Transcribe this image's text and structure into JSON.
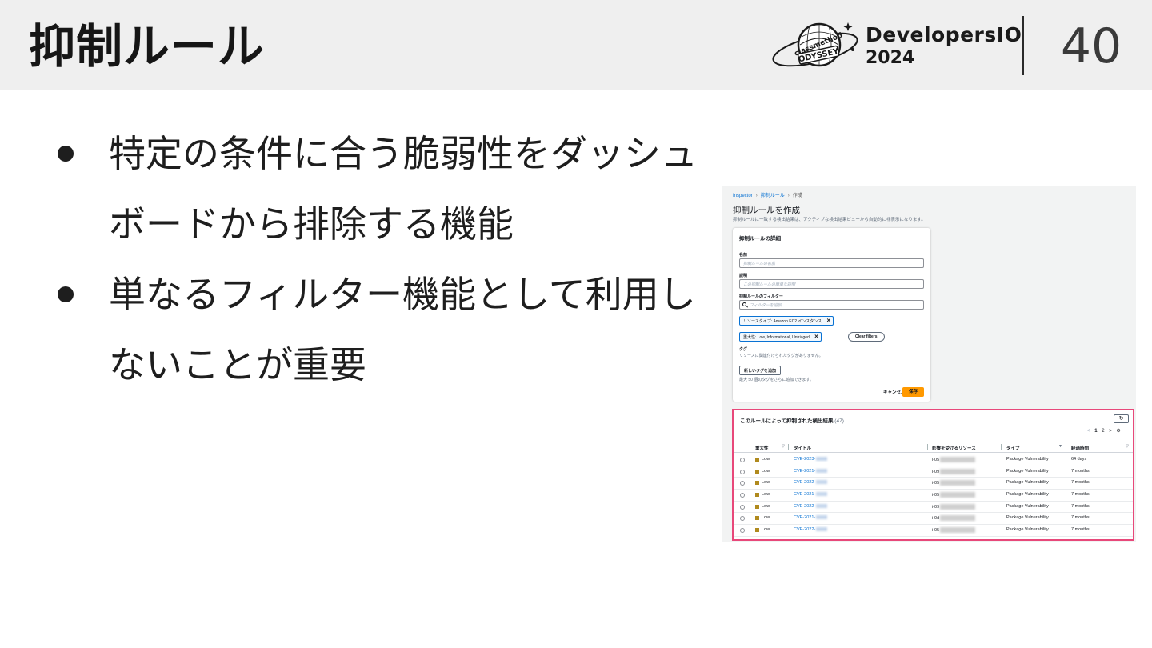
{
  "slide": {
    "title": "抑制ルール",
    "brand": {
      "logo_text_top": "classmethod",
      "logo_text_bottom": "ODYSSEY",
      "name": "DevelopersIO",
      "year": "2024"
    },
    "page_number": "40",
    "bullets": [
      "特定の条件に合う脆弱性をダッシュボードから排除する機能",
      "単なるフィルター機能として利用しないことが重要"
    ]
  },
  "screenshot": {
    "breadcrumb": [
      "Inspector",
      "抑制ルール",
      "作成"
    ],
    "page_title": "抑制ルールを作成",
    "page_desc": "抑制ルールに一致する検出結果は、アクティブな検出結果ビューから自動的に非表示になります。",
    "details_panel": {
      "heading": "抑制ルールの詳細",
      "name_label": "名前",
      "name_placeholder": "抑制ルールの名前",
      "desc_label": "説明",
      "desc_placeholder": "この抑制ルールの簡単な説明",
      "filter_label": "抑制ルールのフィルター",
      "filter_placeholder": "フィルターを追加",
      "token_resource_type": "リソースタイプ: Amazon EC2 インスタンス",
      "token_severity": "重大性: Low, Informational, Untriaged",
      "clear_filters": "Clear filters",
      "tags_label": "タグ",
      "tags_help": "リソースに関連付けられたタグがありません。",
      "add_tag_button": "新しいタグを追加",
      "add_tag_help": "最大 50 個のタグをさらに追加できます。",
      "cancel_button": "キャンセル",
      "save_button": "保存"
    },
    "results": {
      "title": "このルールによって抑制された検出結果",
      "count": "(47)",
      "pager": {
        "prev": "<",
        "pages": [
          "1",
          "2"
        ],
        "next": ">"
      },
      "columns": [
        "重大性",
        "タイトル",
        "影響を受けるリソース",
        "タイプ",
        "経過時間"
      ],
      "rows": [
        {
          "severity": "Low",
          "cve": "CVE-2023-",
          "resource": "i-05",
          "type": "Package Vulnerability",
          "age": "64 days"
        },
        {
          "severity": "Low",
          "cve": "CVE-2021-",
          "resource": "i-09",
          "type": "Package Vulnerability",
          "age": "7 months"
        },
        {
          "severity": "Low",
          "cve": "CVE-2022-",
          "resource": "i-05",
          "type": "Package Vulnerability",
          "age": "7 months"
        },
        {
          "severity": "Low",
          "cve": "CVE-2021-",
          "resource": "i-05",
          "type": "Package Vulnerability",
          "age": "7 months"
        },
        {
          "severity": "Low",
          "cve": "CVE-2022-",
          "resource": "i-09",
          "type": "Package Vulnerability",
          "age": "7 months"
        },
        {
          "severity": "Low",
          "cve": "CVE-2021-",
          "resource": "i-0d",
          "type": "Package Vulnerability",
          "age": "7 months"
        },
        {
          "severity": "Low",
          "cve": "CVE-2022-",
          "resource": "i-05",
          "type": "Package Vulnerability",
          "age": "7 months"
        }
      ]
    }
  },
  "colors": {
    "header_bg": "#efefef",
    "highlight_border": "#e8487a",
    "save_button": "#ff9900",
    "link": "#0972d3",
    "severity_low": "#b08a1e"
  }
}
